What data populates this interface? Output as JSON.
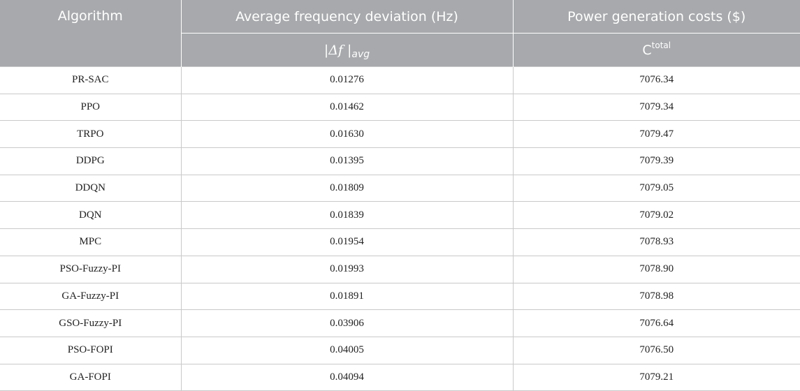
{
  "header": {
    "col1": "Algorithm",
    "col2": "Average frequency deviation (Hz)",
    "col3": "Power generation costs ($)",
    "col2_sub_symbol": "|Δf |",
    "col2_sub_subscript": "avg",
    "col3_sub_symbol": "C",
    "col3_sub_superscript": "total"
  },
  "rows": [
    {
      "algorithm": "PR-SAC",
      "deviation": "0.01276",
      "cost": "7076.34"
    },
    {
      "algorithm": "PPO",
      "deviation": "0.01462",
      "cost": "7079.34"
    },
    {
      "algorithm": "TRPO",
      "deviation": "0.01630",
      "cost": "7079.47"
    },
    {
      "algorithm": "DDPG",
      "deviation": "0.01395",
      "cost": "7079.39"
    },
    {
      "algorithm": "DDQN",
      "deviation": "0.01809",
      "cost": "7079.05"
    },
    {
      "algorithm": "DQN",
      "deviation": "0.01839",
      "cost": "7079.02"
    },
    {
      "algorithm": "MPC",
      "deviation": "0.01954",
      "cost": "7078.93"
    },
    {
      "algorithm": "PSO-Fuzzy-PI",
      "deviation": "0.01993",
      "cost": "7078.90"
    },
    {
      "algorithm": "GA-Fuzzy-PI",
      "deviation": "0.01891",
      "cost": "7078.98"
    },
    {
      "algorithm": "GSO-Fuzzy-PI",
      "deviation": "0.03906",
      "cost": "7076.64"
    },
    {
      "algorithm": "PSO-FOPI",
      "deviation": "0.04005",
      "cost": "7076.50"
    },
    {
      "algorithm": "GA-FOPI",
      "deviation": "0.04094",
      "cost": "7079.21"
    }
  ]
}
